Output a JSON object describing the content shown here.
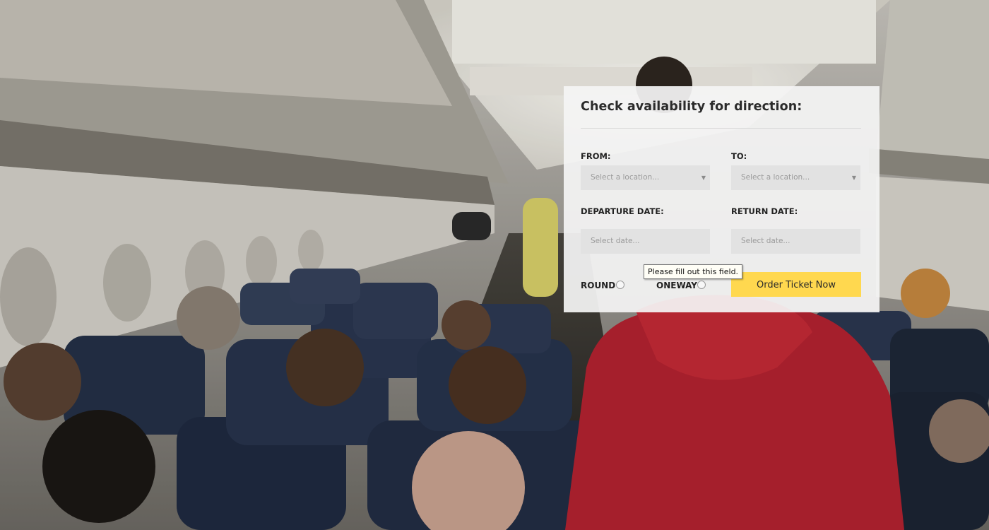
{
  "booking_form": {
    "title": "Check availability for direction:",
    "from": {
      "label": "FROM:",
      "placeholder": "Select a location..."
    },
    "to": {
      "label": "TO:",
      "placeholder": "Select a location..."
    },
    "departure_date": {
      "label": "DEPARTURE DATE:",
      "placeholder": "Select date..."
    },
    "return_date": {
      "label": "RETURN DATE:",
      "placeholder": "Select date..."
    },
    "trip_type": {
      "round_label": "ROUND",
      "oneway_label": "ONEWAY"
    },
    "submit_label": "Order Ticket Now",
    "validation_tooltip": "Please fill out this field."
  },
  "colors": {
    "accent_button": "#ffd84f",
    "panel_background": "#f4f4f4",
    "input_background": "#e2e2e2"
  },
  "icons": [
    "dropdown-caret-icon",
    "radio-icon"
  ]
}
